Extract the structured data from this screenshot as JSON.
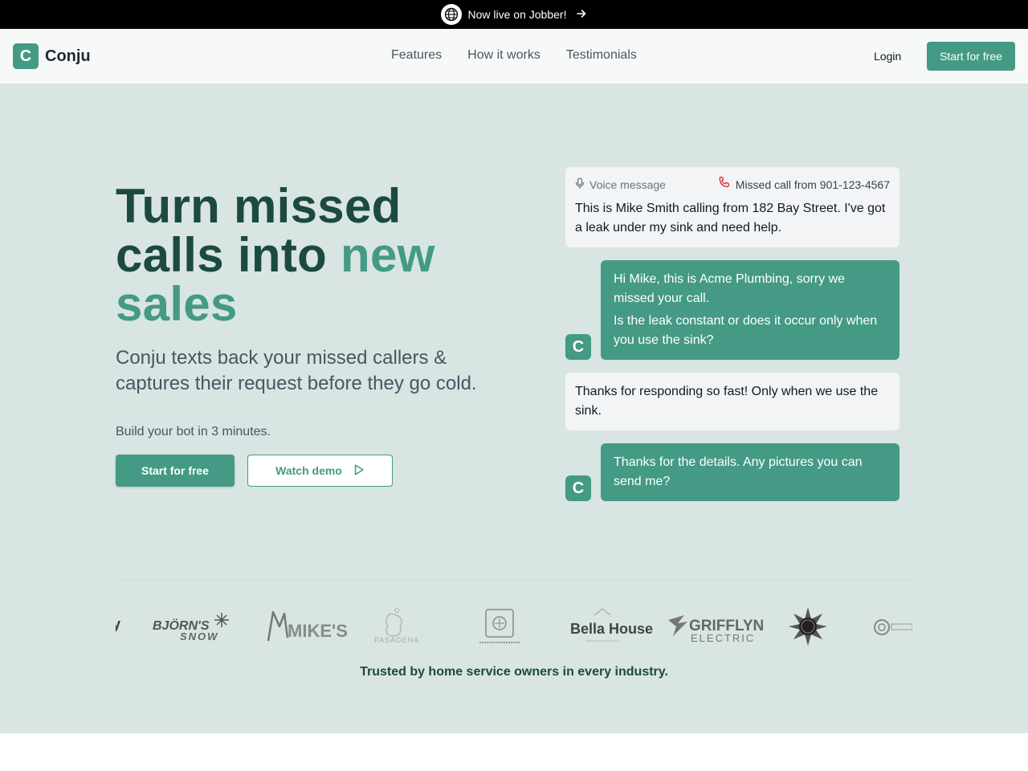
{
  "announcement": {
    "text": "Now live on Jobber!"
  },
  "header": {
    "logo_letter": "C",
    "brand": "Conju",
    "nav": [
      "Features",
      "How it works",
      "Testimonials"
    ],
    "login": "Login",
    "cta": "Start for free"
  },
  "hero": {
    "headline_main": "Turn missed calls into ",
    "headline_accent": "new sales",
    "subhead": "Conju texts back your missed callers & captures their request before they go cold.",
    "build_line": "Build your bot in 3 minutes.",
    "primary_button": "Start for free",
    "secondary_button": "Watch demo"
  },
  "chat": {
    "voice_label": "Voice message",
    "missed_label": "Missed call from 901-123-4567",
    "message1": "This is Mike Smith calling from 182 Bay Street. I've got a leak under my sink and need help.",
    "reply1_line1": "Hi Mike, this is Acme Plumbing, sorry we missed your call.",
    "reply1_line2": "Is the leak constant or does it occur only when you use the sink?",
    "message2": "Thanks for responding so fast! Only when we use the sink.",
    "reply2": "Thanks for the details. Any pictures you can send me?",
    "avatar_letter": "C"
  },
  "logos": {
    "bjorns": "BJÖRN'S",
    "bjorns_sub": "SNOW",
    "mikes": "MIKE'S",
    "pasadena": "PASADENA",
    "bella": "Bella House",
    "griffyn": "GRIFFLYN",
    "griffyn_sub": "ELECTRIC",
    "trusted": "Trusted by home service owners in every industry."
  },
  "colors": {
    "accent": "#449a84",
    "dark_green": "#1c4a3e",
    "hero_bg": "#d8e5e2"
  }
}
